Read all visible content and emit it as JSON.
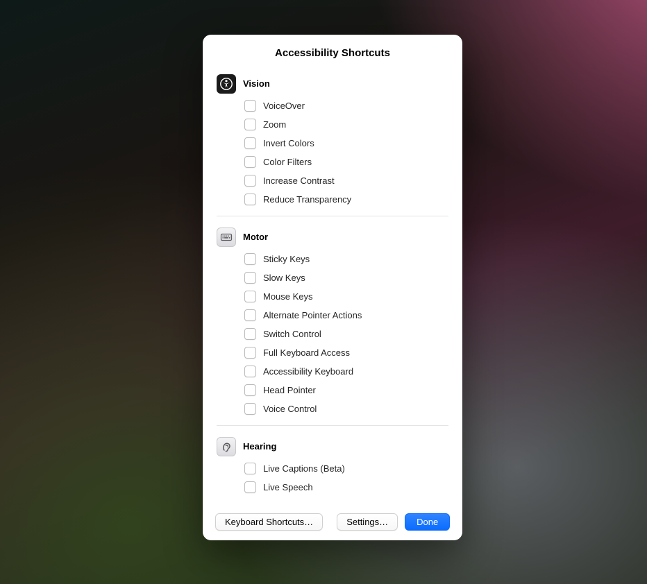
{
  "title": "Accessibility Shortcuts",
  "sections": {
    "vision": {
      "title": "Vision",
      "items": [
        "VoiceOver",
        "Zoom",
        "Invert Colors",
        "Color Filters",
        "Increase Contrast",
        "Reduce Transparency"
      ]
    },
    "motor": {
      "title": "Motor",
      "items": [
        "Sticky Keys",
        "Slow Keys",
        "Mouse Keys",
        "Alternate Pointer Actions",
        "Switch Control",
        "Full Keyboard Access",
        "Accessibility Keyboard",
        "Head Pointer",
        "Voice Control"
      ]
    },
    "hearing": {
      "title": "Hearing",
      "items": [
        "Live Captions (Beta)",
        "Live Speech"
      ]
    }
  },
  "buttons": {
    "keyboard_shortcuts": "Keyboard Shortcuts…",
    "settings": "Settings…",
    "done": "Done"
  }
}
